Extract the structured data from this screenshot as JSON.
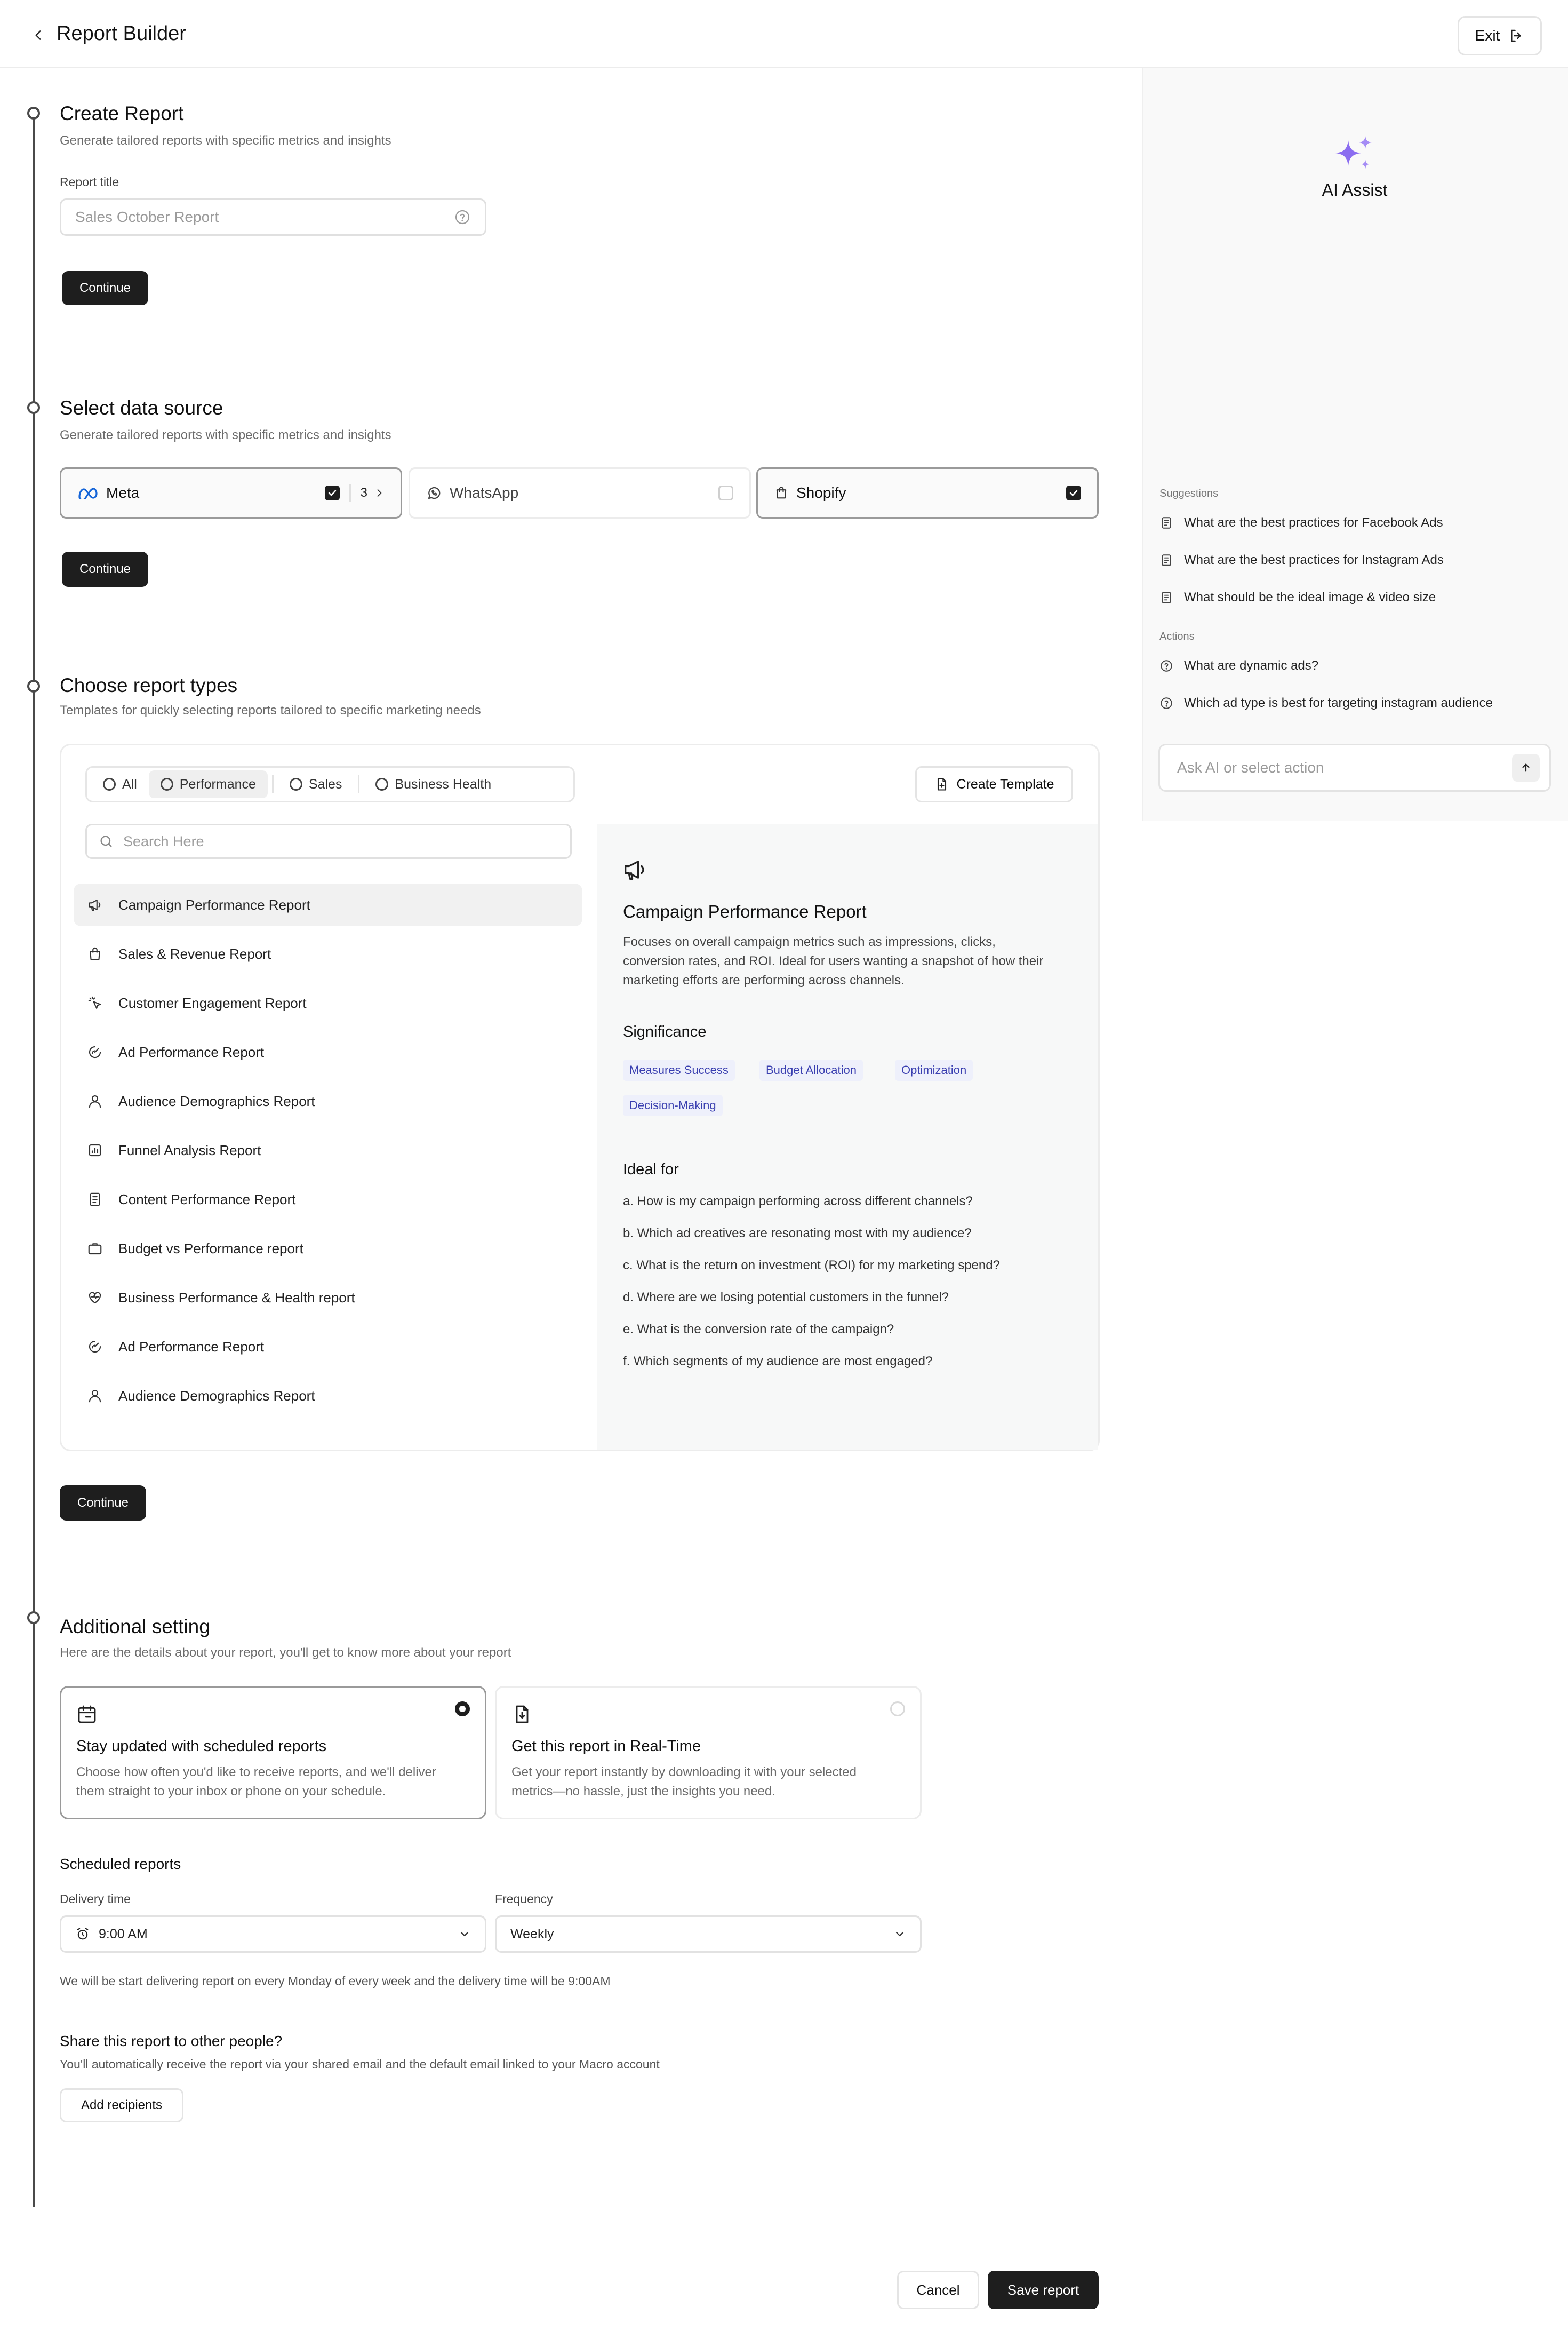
{
  "header": {
    "title": "Report Builder",
    "exit_label": "Exit"
  },
  "step1": {
    "title": "Create Report",
    "subtitle": "Generate tailored reports with specific metrics and insights",
    "field_label": "Report title",
    "placeholder": "Sales October Report",
    "continue_label": "Continue"
  },
  "step2": {
    "title": "Select data source",
    "subtitle": "Generate tailored reports with specific metrics and insights",
    "sources": [
      {
        "name": "Meta",
        "checked": true,
        "count": "3"
      },
      {
        "name": "WhatsApp",
        "checked": false
      },
      {
        "name": "Shopify",
        "checked": true
      }
    ],
    "continue_label": "Continue"
  },
  "step3": {
    "title": "Choose report types",
    "subtitle": "Templates for quickly selecting reports tailored to specific marketing needs",
    "filters": [
      "All",
      "Performance",
      "Sales",
      "Business Health"
    ],
    "active_filter": "Performance",
    "create_template_label": "Create Template",
    "search_placeholder": "Search Here",
    "reports": [
      {
        "label": "Campaign Performance Report",
        "icon": "megaphone-icon"
      },
      {
        "label": "Sales & Revenue Report",
        "icon": "shopping-bag-icon"
      },
      {
        "label": "Customer Engagement Report",
        "icon": "pointer-click-icon"
      },
      {
        "label": "Ad Performance Report",
        "icon": "gauge-icon"
      },
      {
        "label": "Audience Demographics Report",
        "icon": "user-icon"
      },
      {
        "label": "Funnel Analysis Report",
        "icon": "chart-icon"
      },
      {
        "label": "Content Performance Report",
        "icon": "document-icon"
      },
      {
        "label": "Budget vs Performance report",
        "icon": "briefcase-icon"
      },
      {
        "label": "Business Performance & Health report",
        "icon": "heart-pulse-icon"
      },
      {
        "label": "Ad Performance Report",
        "icon": "gauge-icon"
      },
      {
        "label": "Audience Demographics Report",
        "icon": "user-icon"
      }
    ],
    "detail": {
      "title": "Campaign Performance Report",
      "description_lines": [
        "Focuses on overall campaign metrics such as impressions, clicks,",
        "conversion rates, and ROI. Ideal for users wanting a snapshot of how their",
        "marketing efforts are performing across channels."
      ],
      "significance_label": "Significance",
      "tags": [
        "Measures Success",
        "Budget Allocation",
        "Optimization",
        "Decision-Making"
      ],
      "ideal_label": "Ideal for",
      "ideal_for": [
        "a. How is my campaign performing across different channels?",
        "b. Which ad creatives are resonating most with my audience?",
        "c. What is the return on investment (ROI) for my marketing spend?",
        "d. Where are we losing potential customers in the funnel?",
        "e. What is the conversion rate of the campaign?",
        "f. Which segments of my audience are most engaged?"
      ]
    },
    "continue_label": "Continue"
  },
  "step4": {
    "title": "Additional setting",
    "subtitle": "Here are the details about your report, you'll get to know more about your report",
    "options": [
      {
        "title": "Stay updated with scheduled reports",
        "desc_lines": [
          "Choose how often you'd like to receive reports, and we'll deliver",
          "them straight to your inbox or phone on your schedule."
        ],
        "selected": true
      },
      {
        "title": "Get this report in Real-Time",
        "desc_lines": [
          "Get your report instantly by downloading it with your selected",
          "metrics—no hassle, just the insights you need."
        ],
        "selected": false
      }
    ],
    "scheduled_label": "Scheduled reports",
    "delivery_label": "Delivery time",
    "delivery_value": "9:00 AM",
    "frequency_label": "Frequency",
    "frequency_value": "Weekly",
    "schedule_note": "We will be start delivering report on every Monday of every week and the delivery time will be 9:00AM",
    "share_title": "Share this report to other people?",
    "share_sub": "You'll automatically receive the report via your shared email and the default email linked to your Macro account",
    "add_recipients_label": "Add recipients"
  },
  "footer": {
    "cancel_label": "Cancel",
    "save_label": "Save report"
  },
  "ai": {
    "title": "AI Assist",
    "suggestions_label": "Suggestions",
    "suggestions": [
      "What are the best practices for Facebook Ads",
      "What are the best practices for Instagram Ads",
      "What should be the ideal image & video size"
    ],
    "actions_label": "Actions",
    "actions": [
      "What are dynamic ads?",
      "Which ad type is best for targeting instagram audience"
    ],
    "input_placeholder": "Ask AI or select action"
  },
  "colors": {
    "primary_dark": "#1e1e1e",
    "tag_bg": "#eef0fb",
    "tag_text": "#3a3fb0",
    "ai_sparkle": "#8b6df0"
  }
}
